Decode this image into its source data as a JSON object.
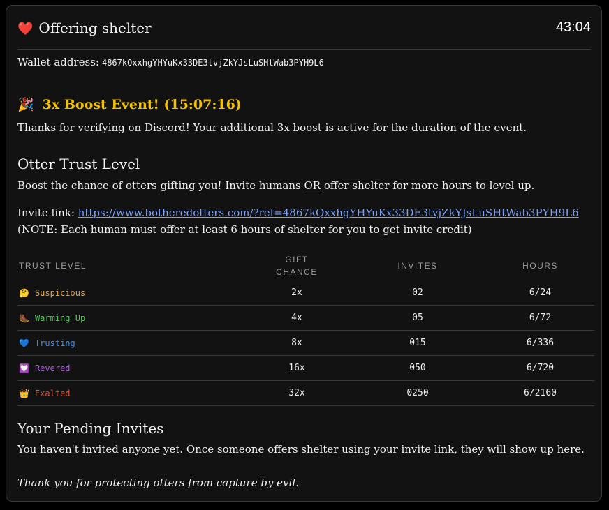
{
  "header": {
    "icon": "heart-icon",
    "title": "Offering shelter",
    "timer": "43:04"
  },
  "wallet": {
    "label": "Wallet address:",
    "address": "4867kQxxhgYHYuKx33DE3tvjZkYJsLuSHtWab3PYH9L6"
  },
  "boost": {
    "icon": "party-popper-icon",
    "title": "3x Boost Event! (15:07:16)",
    "text": "Thanks for verifying on Discord! Your additional 3x boost is active for the duration of the event.",
    "color": "#f5c200"
  },
  "trust": {
    "heading": "Otter Trust Level",
    "desc_before": "Boost the chance of otters gifting you! Invite humans ",
    "desc_or": "OR",
    "desc_after": " offer shelter for more hours to level up.",
    "invite_label": "Invite link:",
    "invite_url": "https://www.botheredotters.com/?ref=4867kQxxhgYHYuKx33DE3tvjZkYJsLuSHtWab3PYH9L6",
    "note": "(NOTE: Each human must offer at least 6 hours of shelter for you to get invite credit)"
  },
  "table": {
    "headers": [
      "TRUST LEVEL",
      "GIFT CHANCE",
      "INVITES",
      "HOURS"
    ],
    "rows": [
      {
        "emoji": "🤔",
        "icon": "thinking-face-icon",
        "level": "Suspicious",
        "color": "#e8a33a",
        "chance": "2x",
        "invites": "02",
        "hours": "6/24"
      },
      {
        "emoji": "🥾",
        "icon": "boot-icon",
        "level": "Warming Up",
        "color": "#56c25a",
        "chance": "4x",
        "invites": "05",
        "hours": "6/72"
      },
      {
        "emoji": "💙",
        "icon": "blue-heart-icon",
        "level": "Trusting",
        "color": "#3b8ff0",
        "chance": "8x",
        "invites": "015",
        "hours": "6/336"
      },
      {
        "emoji": "💟",
        "icon": "heart-decoration-icon",
        "level": "Revered",
        "color": "#b158e6",
        "chance": "16x",
        "invites": "050",
        "hours": "6/720"
      },
      {
        "emoji": "👑",
        "icon": "crown-icon",
        "level": "Exalted",
        "color": "#e0562c",
        "chance": "32x",
        "invites": "0250",
        "hours": "6/2160"
      }
    ]
  },
  "pending": {
    "heading": "Your Pending Invites",
    "text": "You haven't invited anyone yet. Once someone offers shelter using your invite link, they will show up here."
  },
  "footer": {
    "text": "Thank you for protecting otters from capture by evil."
  }
}
